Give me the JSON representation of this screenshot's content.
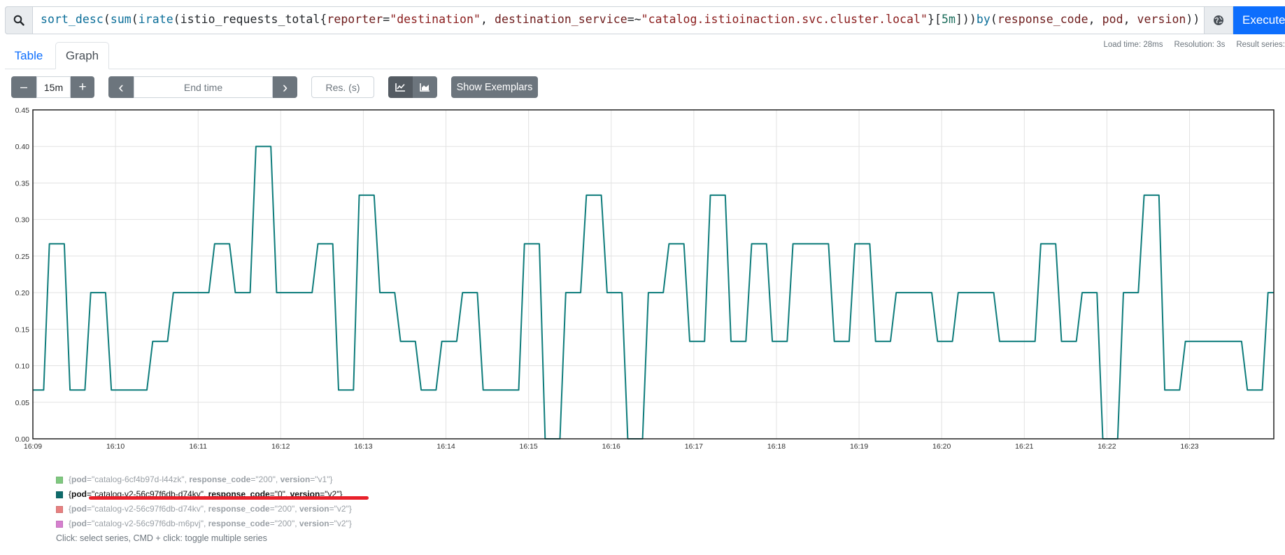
{
  "query": {
    "tokens": [
      {
        "t": "sort_desc",
        "c": "fn"
      },
      {
        "t": "(",
        "c": ""
      },
      {
        "t": "sum",
        "c": "fn"
      },
      {
        "t": "(",
        "c": ""
      },
      {
        "t": "irate",
        "c": "fn"
      },
      {
        "t": "(",
        "c": ""
      },
      {
        "t": "istio_requests_total",
        "c": "metric"
      },
      {
        "t": "{",
        "c": ""
      },
      {
        "t": "reporter",
        "c": "lbl"
      },
      {
        "t": "=",
        "c": ""
      },
      {
        "t": "\"destination\"",
        "c": "str"
      },
      {
        "t": ", ",
        "c": ""
      },
      {
        "t": "destination_service",
        "c": "lbl"
      },
      {
        "t": "=~",
        "c": ""
      },
      {
        "t": "\"catalog.istioinaction.svc.cluster.local\"",
        "c": "str"
      },
      {
        "t": "}",
        "c": ""
      },
      {
        "t": "[",
        "c": ""
      },
      {
        "t": "5m",
        "c": "num"
      },
      {
        "t": "]",
        "c": ""
      },
      {
        "t": "))",
        "c": ""
      },
      {
        "t": "by",
        "c": "kw"
      },
      {
        "t": "(",
        "c": ""
      },
      {
        "t": "response_code",
        "c": "lbl"
      },
      {
        "t": ", ",
        "c": ""
      },
      {
        "t": "pod",
        "c": "lbl"
      },
      {
        "t": ", ",
        "c": ""
      },
      {
        "t": "version",
        "c": "lbl"
      },
      {
        "t": "))",
        "c": ""
      }
    ],
    "execute_label": "Execute"
  },
  "stats": {
    "load_time": "Load time: 28ms",
    "resolution": "Resolution: 3s",
    "result_series": "Result series:"
  },
  "tabs": [
    {
      "label": "Table",
      "active": false
    },
    {
      "label": "Graph",
      "active": true
    }
  ],
  "controls": {
    "minus": "–",
    "range": "15m",
    "plus": "+",
    "prev": "‹",
    "end_time_placeholder": "End time",
    "next": "›",
    "resolution_placeholder": "Res. (s)",
    "show_exemplars": "Show Exemplars"
  },
  "chart_data": {
    "type": "line",
    "ylim": [
      0,
      0.45
    ],
    "y_ticks": [
      "0.00",
      "0.05",
      "0.10",
      "0.15",
      "0.20",
      "0.25",
      "0.30",
      "0.35",
      "0.40",
      "0.45"
    ],
    "x_ticks": [
      "16:09",
      "16:10",
      "16:11",
      "16:12",
      "16:13",
      "16:14",
      "16:15",
      "16:16",
      "16:17",
      "16:18",
      "16:19",
      "16:20",
      "16:21",
      "16:22",
      "16:23"
    ],
    "x_range_minutes": [
      0,
      15.02
    ],
    "series": [
      {
        "label": "{pod=\"catalog-v2-56c97f6db-d74kv\", response_code=\"0\", version=\"v2\"}",
        "color": "#0e7c7b",
        "points": [
          [
            0.0,
            0.0667
          ],
          [
            0.13,
            0.0667
          ],
          [
            0.2,
            0.2667
          ],
          [
            0.38,
            0.2667
          ],
          [
            0.45,
            0.0667
          ],
          [
            0.63,
            0.0667
          ],
          [
            0.7,
            0.2
          ],
          [
            0.88,
            0.2
          ],
          [
            0.95,
            0.0667
          ],
          [
            1.38,
            0.0667
          ],
          [
            1.45,
            0.1333
          ],
          [
            1.63,
            0.1333
          ],
          [
            1.7,
            0.2
          ],
          [
            2.13,
            0.2
          ],
          [
            2.2,
            0.2667
          ],
          [
            2.38,
            0.2667
          ],
          [
            2.45,
            0.2
          ],
          [
            2.63,
            0.2
          ],
          [
            2.7,
            0.4
          ],
          [
            2.88,
            0.4
          ],
          [
            2.95,
            0.2
          ],
          [
            3.38,
            0.2
          ],
          [
            3.45,
            0.2667
          ],
          [
            3.63,
            0.2667
          ],
          [
            3.7,
            0.0667
          ],
          [
            3.88,
            0.0667
          ],
          [
            3.95,
            0.3333
          ],
          [
            4.13,
            0.3333
          ],
          [
            4.2,
            0.2
          ],
          [
            4.38,
            0.2
          ],
          [
            4.45,
            0.1333
          ],
          [
            4.63,
            0.1333
          ],
          [
            4.7,
            0.0667
          ],
          [
            4.88,
            0.0667
          ],
          [
            4.95,
            0.1333
          ],
          [
            5.13,
            0.1333
          ],
          [
            5.2,
            0.2
          ],
          [
            5.38,
            0.2
          ],
          [
            5.45,
            0.0667
          ],
          [
            5.88,
            0.0667
          ],
          [
            5.95,
            0.2667
          ],
          [
            6.13,
            0.2667
          ],
          [
            6.2,
            0.0
          ],
          [
            6.38,
            0.0
          ],
          [
            6.45,
            0.2
          ],
          [
            6.63,
            0.2
          ],
          [
            6.7,
            0.3333
          ],
          [
            6.88,
            0.3333
          ],
          [
            6.95,
            0.2
          ],
          [
            7.13,
            0.2
          ],
          [
            7.2,
            0.0
          ],
          [
            7.38,
            0.0
          ],
          [
            7.45,
            0.2
          ],
          [
            7.63,
            0.2
          ],
          [
            7.7,
            0.2667
          ],
          [
            7.88,
            0.2667
          ],
          [
            7.95,
            0.1333
          ],
          [
            8.13,
            0.1333
          ],
          [
            8.2,
            0.3333
          ],
          [
            8.38,
            0.3333
          ],
          [
            8.45,
            0.1333
          ],
          [
            8.63,
            0.1333
          ],
          [
            8.7,
            0.2667
          ],
          [
            8.88,
            0.2667
          ],
          [
            8.95,
            0.1333
          ],
          [
            9.13,
            0.1333
          ],
          [
            9.2,
            0.2667
          ],
          [
            9.63,
            0.2667
          ],
          [
            9.7,
            0.1333
          ],
          [
            9.88,
            0.1333
          ],
          [
            9.95,
            0.2667
          ],
          [
            10.13,
            0.2667
          ],
          [
            10.2,
            0.1333
          ],
          [
            10.38,
            0.1333
          ],
          [
            10.45,
            0.2
          ],
          [
            10.88,
            0.2
          ],
          [
            10.95,
            0.1333
          ],
          [
            11.13,
            0.1333
          ],
          [
            11.2,
            0.2
          ],
          [
            11.63,
            0.2
          ],
          [
            11.7,
            0.1333
          ],
          [
            12.13,
            0.1333
          ],
          [
            12.2,
            0.2667
          ],
          [
            12.38,
            0.2667
          ],
          [
            12.45,
            0.1333
          ],
          [
            12.63,
            0.1333
          ],
          [
            12.7,
            0.2
          ],
          [
            12.88,
            0.2
          ],
          [
            12.95,
            0.0
          ],
          [
            13.13,
            0.0
          ],
          [
            13.2,
            0.2
          ],
          [
            13.38,
            0.2
          ],
          [
            13.45,
            0.3333
          ],
          [
            13.63,
            0.3333
          ],
          [
            13.7,
            0.0667
          ],
          [
            13.88,
            0.0667
          ],
          [
            13.95,
            0.1333
          ],
          [
            14.63,
            0.1333
          ],
          [
            14.7,
            0.0667
          ],
          [
            14.88,
            0.0667
          ],
          [
            14.95,
            0.2
          ],
          [
            15.02,
            0.2
          ]
        ]
      }
    ]
  },
  "legend": [
    {
      "pod": "\"catalog-6cf4b97d-l44zk\"",
      "response_code": "\"200\"",
      "version": "\"v1\"",
      "color": "#7fc97f",
      "active": false
    },
    {
      "pod": "\"catalog-v2-56c97f6db-d74kv\"",
      "response_code": "\"0\"",
      "version": "\"v2\"",
      "color": "#0e6b6b",
      "active": true
    },
    {
      "pod": "\"catalog-v2-56c97f6db-d74kv\"",
      "response_code": "\"200\"",
      "version": "\"v2\"",
      "color": "#e88080",
      "active": false
    },
    {
      "pod": "\"catalog-v2-56c97f6db-m6pvj\"",
      "response_code": "\"200\"",
      "version": "\"v2\"",
      "color": "#d67fcf",
      "active": false
    }
  ],
  "legend_keys": {
    "pod": "pod",
    "response_code": "response_code",
    "version": "version"
  },
  "legend_help": "Click: select series, CMD + click: toggle multiple series"
}
